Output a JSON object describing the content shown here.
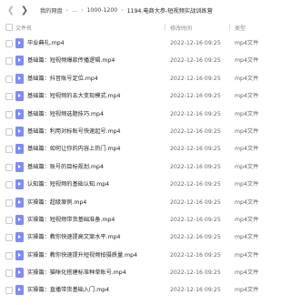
{
  "nav": {
    "back_icon": "chevron-left-icon",
    "forward_icon": "chevron-right-icon",
    "breadcrumb": [
      "我的网盘",
      "...",
      "1000-1200",
      "1194.电商大参-短视频实战训练营"
    ]
  },
  "table": {
    "headers": {
      "name": "文件名",
      "time": "修改时间",
      "type": "类型"
    },
    "rows": [
      {
        "name": "毕业典礼.mp4",
        "time": "2022-12-16 09:25",
        "type": "mp4文件"
      },
      {
        "name": "基础篇：短视频爆款传播逻辑.mp4",
        "time": "2022-12-16 09:25",
        "type": "mp4文件"
      },
      {
        "name": "基础篇：抖音账号定位.mp4",
        "time": "2022-12-16 09:25",
        "type": "mp4文件"
      },
      {
        "name": "基础篇：短视频的五大变现模式.mp4",
        "time": "2022-12-16 09:25",
        "type": "mp4文件"
      },
      {
        "name": "基础篇：短视频选题技巧.mp4",
        "time": "2022-12-16 09:25",
        "type": "mp4文件"
      },
      {
        "name": "基础篇：利用对标账号快速起号.mp4",
        "time": "2022-12-16 09:25",
        "type": "mp4文件"
      },
      {
        "name": "基础篇：如何让你的内容上热门.mp4",
        "time": "2022-12-16 09:25",
        "type": "mp4文件"
      },
      {
        "name": "基础篇：账号的目标规划.mp4",
        "time": "2022-12-16 09:25",
        "type": "mp4文件"
      },
      {
        "name": "认知篇：短视频的基础认知.mp4",
        "time": "2022-12-16 09:25",
        "type": "mp4文件"
      },
      {
        "name": "实操篇：超级案例.mp4",
        "time": "2022-12-16 09:25",
        "type": "mp4文件"
      },
      {
        "name": "实操篇：短视频带货基础准备.mp4",
        "time": "2022-12-16 09:25",
        "type": "mp4文件"
      },
      {
        "name": "实操篇：教你快速提高文案水平.mp4",
        "time": "2022-12-16 09:25",
        "type": "mp4文件"
      },
      {
        "name": "实操篇：教你快速提升短视频拍摄质量.mp4",
        "time": "2022-12-16 09:25",
        "type": "mp4文件"
      },
      {
        "name": "实操篇：猫咪化搭建标准种草账号.mp4",
        "time": "2022-12-16 09:25",
        "type": "mp4文件"
      },
      {
        "name": "实操篇：直播带货基础入门.mp4",
        "time": "2022-12-16 09:25",
        "type": "mp4文件"
      }
    ]
  },
  "icons": {
    "file_icon": "video-file-icon",
    "checkbox_icon": "checkbox-icon"
  },
  "colors": {
    "file_icon": "#7f8cf5",
    "header_text": "#8a8a8a"
  }
}
